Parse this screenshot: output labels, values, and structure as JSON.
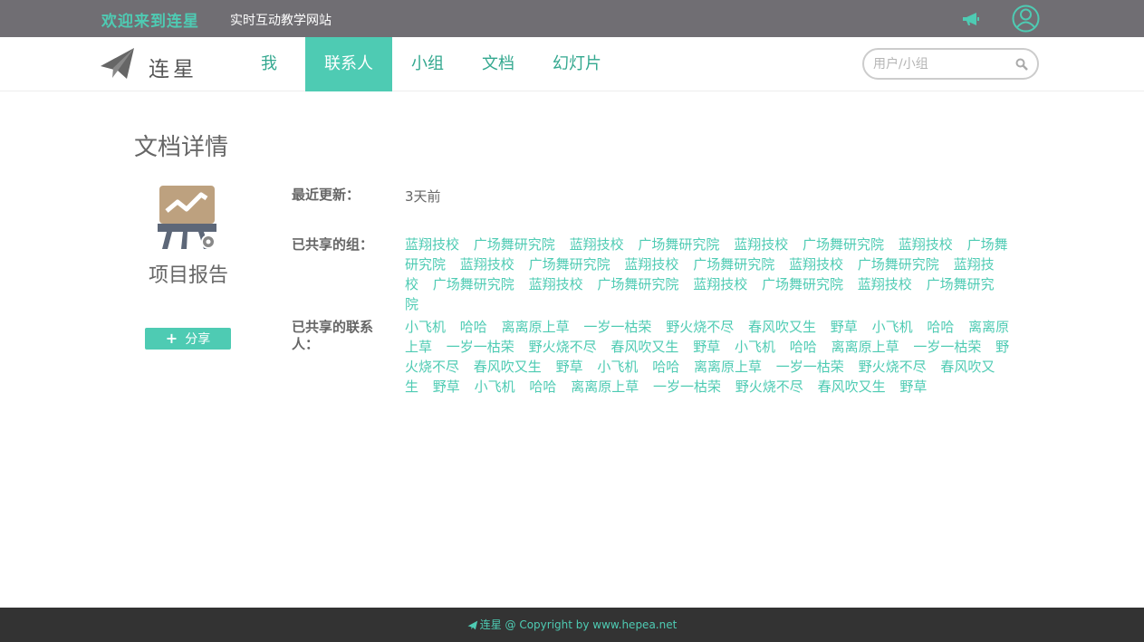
{
  "topbar": {
    "welcome": "欢迎来到连星",
    "tagline": "实时互动教学网站",
    "icons": [
      "megaphone-icon",
      "user-icon"
    ]
  },
  "nav": {
    "logo_text": "连星",
    "items": [
      {
        "label": "我",
        "active": false
      },
      {
        "label": "联系人",
        "active": true
      },
      {
        "label": "小组",
        "active": false
      },
      {
        "label": "文档",
        "active": false
      },
      {
        "label": "幻灯片",
        "active": false
      }
    ],
    "search_placeholder": "用户/小组"
  },
  "main": {
    "title": "文档详情",
    "doc_name": "项目报告",
    "share_label": "分享",
    "updated_label": "最近更新：",
    "updated_value": "3天前",
    "groups_label": "已共享的组：",
    "groups": [
      "蓝翔技校",
      "广场舞研究院",
      "蓝翔技校",
      "广场舞研究院",
      "蓝翔技校",
      "广场舞研究院",
      "蓝翔技校",
      "广场舞研究院",
      "蓝翔技校",
      "广场舞研究院",
      "蓝翔技校",
      "广场舞研究院",
      "蓝翔技校",
      "广场舞研究院",
      "蓝翔技校",
      "广场舞研究院",
      "蓝翔技校",
      "广场舞研究院",
      "蓝翔技校",
      "广场舞研究院",
      "蓝翔技校",
      "广场舞研究院"
    ],
    "contacts_label": "已共享的联系人：",
    "contacts": [
      "小飞机",
      "哈哈",
      "离离原上草",
      "一岁一枯荣",
      "野火烧不尽",
      "春风吹又生",
      "野草",
      "小飞机",
      "哈哈",
      "离离原上草",
      "一岁一枯荣",
      "野火烧不尽",
      "春风吹又生",
      "野草",
      "小飞机",
      "哈哈",
      "离离原上草",
      "一岁一枯荣",
      "野火烧不尽",
      "春风吹又生",
      "野草",
      "小飞机",
      "哈哈",
      "离离原上草",
      "一岁一枯荣",
      "野火烧不尽",
      "春风吹又生",
      "野草",
      "小飞机",
      "哈哈",
      "离离原上草",
      "一岁一枯荣",
      "野火烧不尽",
      "春风吹又生",
      "野草"
    ]
  },
  "footer": {
    "text": "连星 @ Copyright by www.hepea.net"
  },
  "colors": {
    "accent": "#4ecbb3",
    "topbar_bg": "#706e73",
    "footer_bg": "#333333"
  }
}
